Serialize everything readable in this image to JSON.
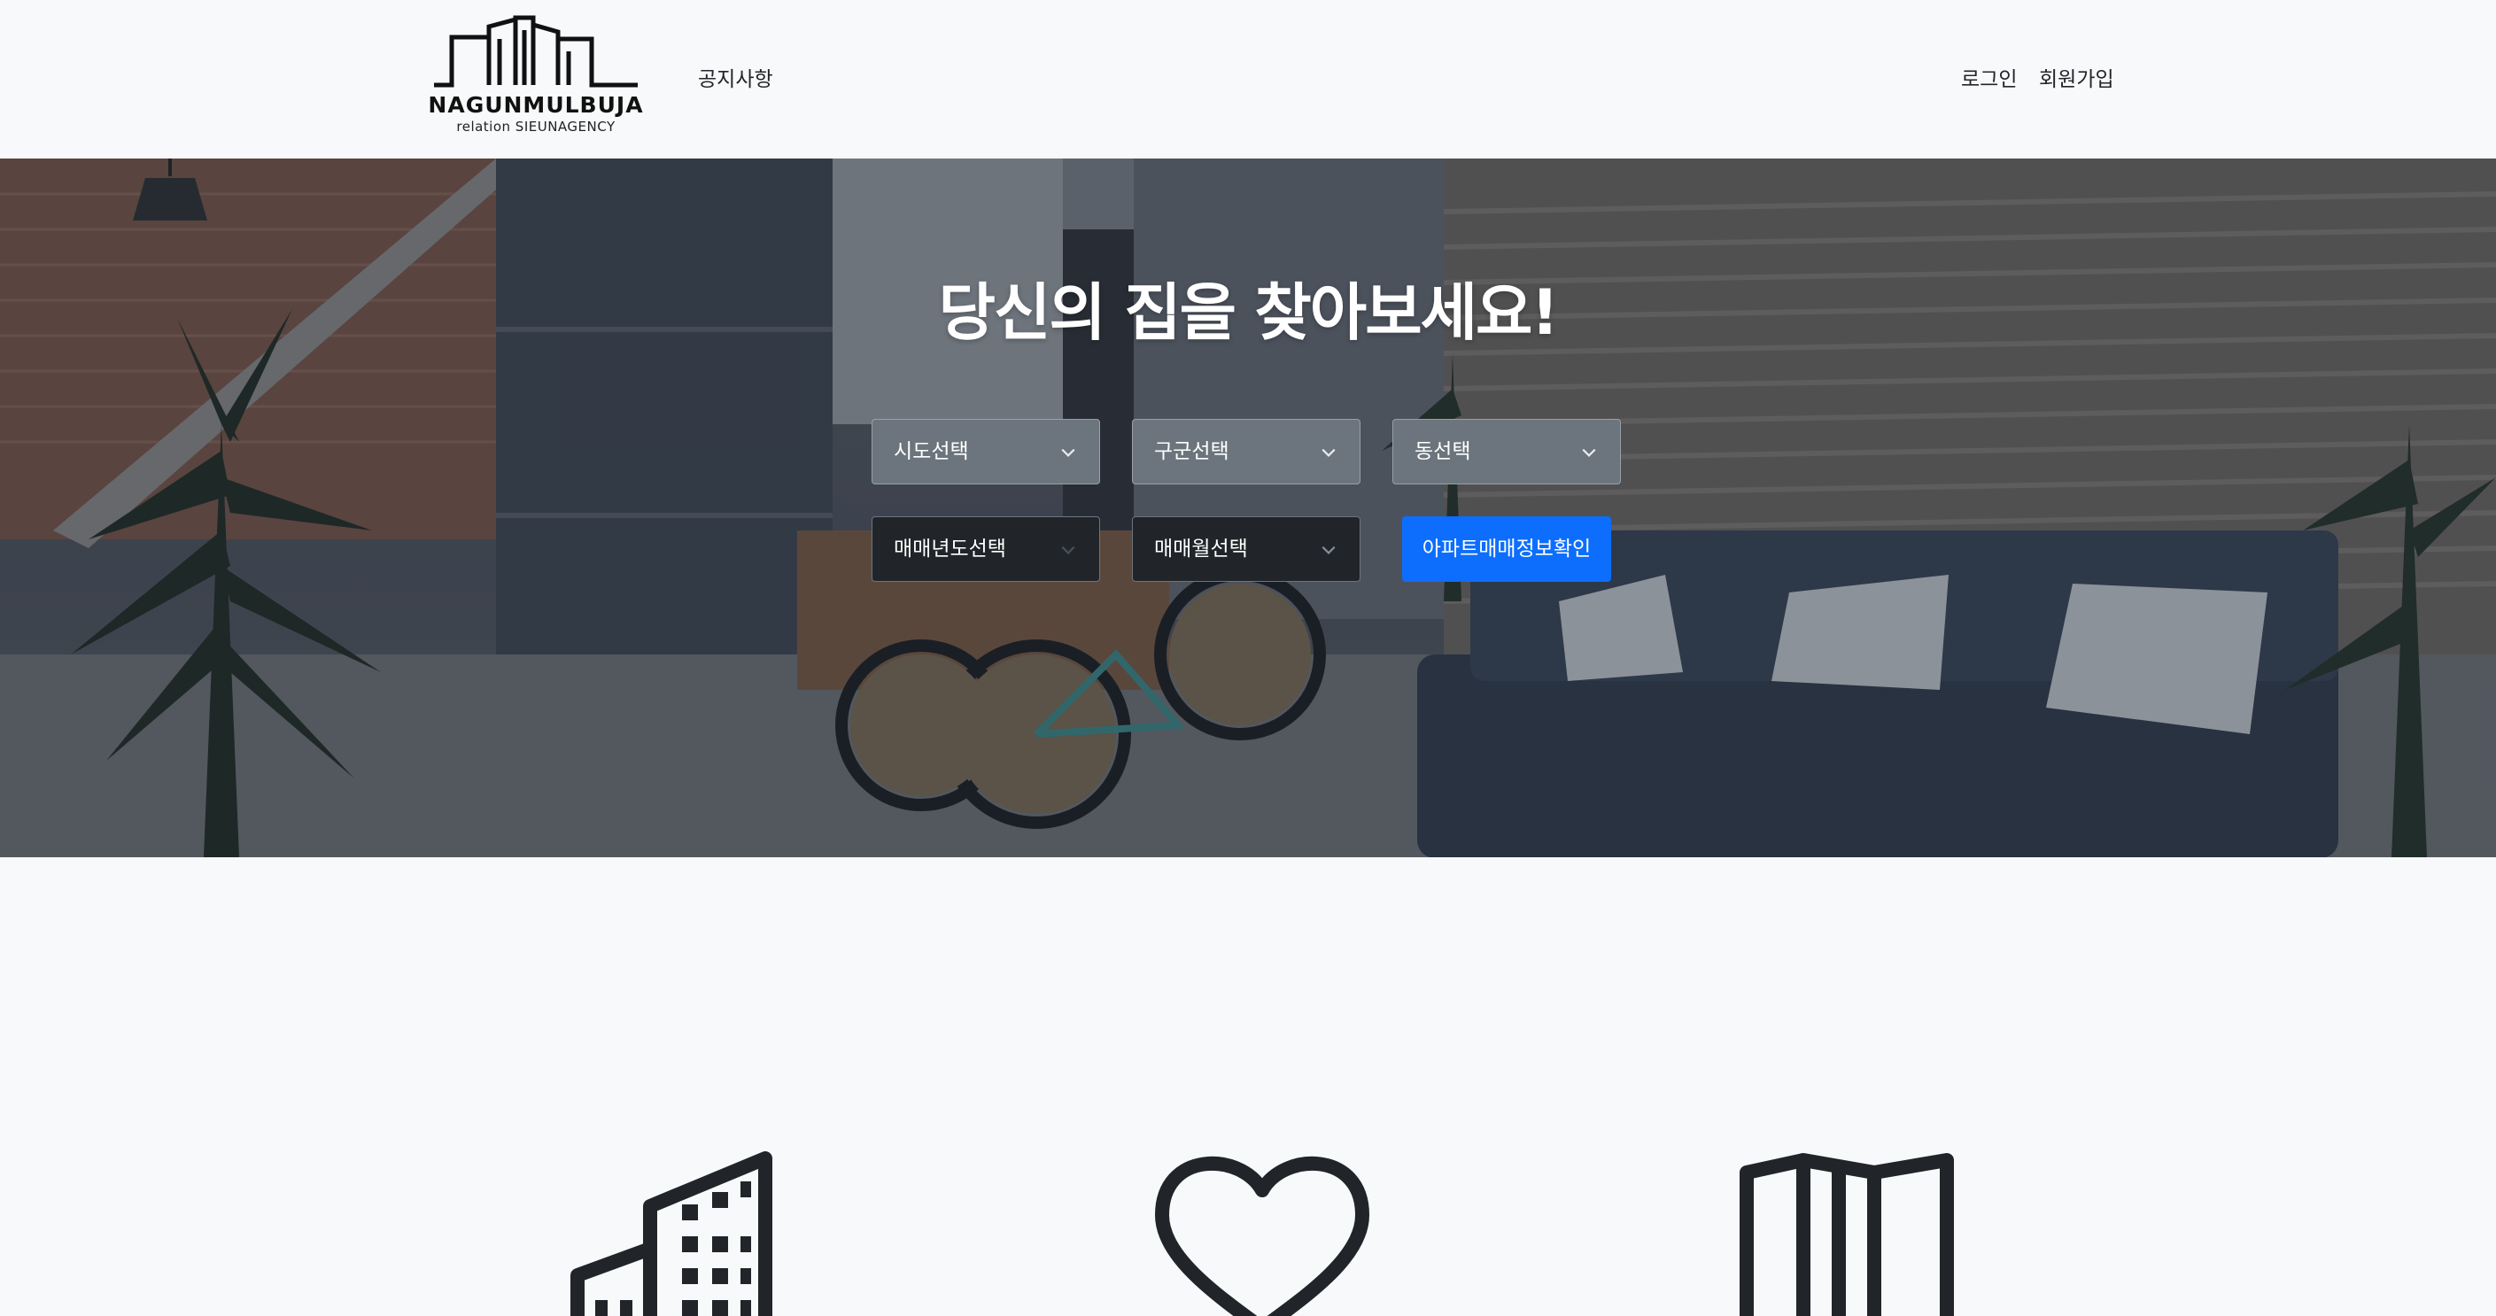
{
  "brand": {
    "name": "NAGUNMULBUJA",
    "sub": "relation SIEUNAGENCY"
  },
  "nav": {
    "notice": "공지사항",
    "login": "로그인",
    "signup": "회원가입"
  },
  "hero": {
    "title": "당신의 집을 찾아보세요!",
    "selects": {
      "sido": "시도선택",
      "gugun": "구군선택",
      "dong": "동선택",
      "year": "매매년도선택",
      "month": "매매월선택"
    },
    "search_button": "아파트매매정보확인"
  },
  "features": {
    "icons": [
      "building-icon",
      "heart-icon",
      "map-icon"
    ]
  },
  "colors": {
    "primary": "#0d6efd",
    "select_light": "#6c757d",
    "select_dark": "#212529",
    "page_bg": "#f8f9fa"
  }
}
